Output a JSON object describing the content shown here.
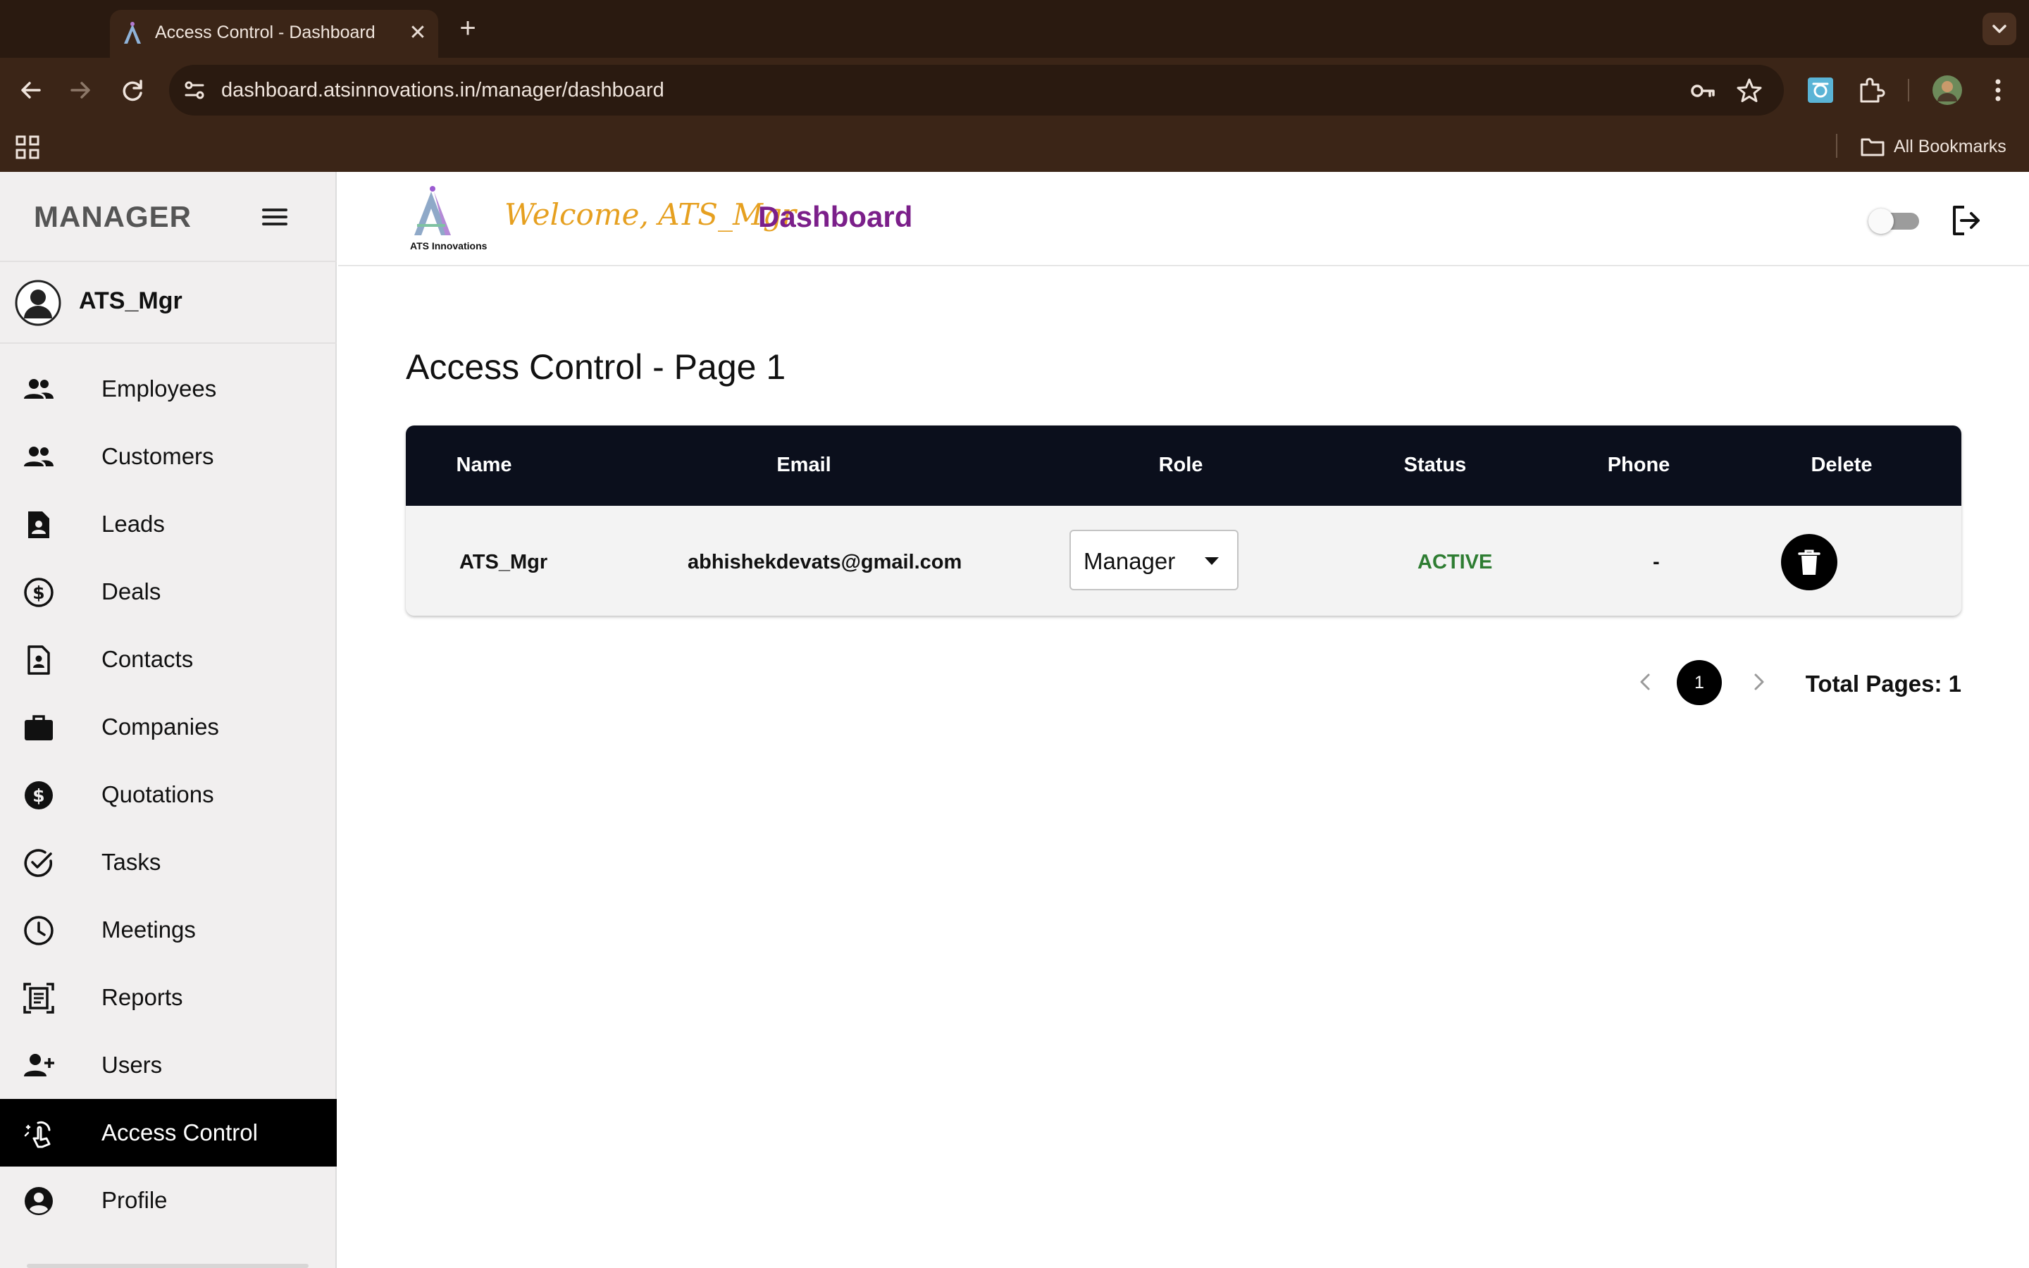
{
  "browser": {
    "tab_title": "Access Control - Dashboard",
    "url": "dashboard.atsinnovations.in/manager/dashboard",
    "bookmarks_label": "All Bookmarks"
  },
  "sidebar": {
    "title": "MANAGER",
    "username": "ATS_Mgr",
    "items": [
      {
        "label": "Employees",
        "icon": "people-icon"
      },
      {
        "label": "Customers",
        "icon": "people-icon"
      },
      {
        "label": "Leads",
        "icon": "document-person-icon"
      },
      {
        "label": "Deals",
        "icon": "dollar-circle-outline-icon"
      },
      {
        "label": "Contacts",
        "icon": "contact-page-icon"
      },
      {
        "label": "Companies",
        "icon": "briefcase-icon"
      },
      {
        "label": "Quotations",
        "icon": "dollar-circle-filled-icon"
      },
      {
        "label": "Tasks",
        "icon": "check-circle-icon"
      },
      {
        "label": "Meetings",
        "icon": "clock-icon"
      },
      {
        "label": "Reports",
        "icon": "document-scanner-icon"
      },
      {
        "label": "Users",
        "icon": "person-add-icon"
      },
      {
        "label": "Access Control",
        "icon": "touch-app-icon",
        "active": true
      },
      {
        "label": "Profile",
        "icon": "account-circle-icon"
      }
    ]
  },
  "header": {
    "logo_text": "ATS Innovations",
    "welcome": "Welcome, ATS_Mgr",
    "title": "Dashboard"
  },
  "main": {
    "heading": "Access Control - Page 1",
    "table": {
      "columns": [
        "Name",
        "Email",
        "Role",
        "Status",
        "Phone",
        "Delete"
      ],
      "rows": [
        {
          "name": "ATS_Mgr",
          "email": "abhishekdevats@gmail.com",
          "role": "Manager",
          "status": "ACTIVE",
          "phone": "-"
        }
      ]
    },
    "pagination": {
      "current_page": "1",
      "total_label": "Total Pages: 1"
    }
  },
  "colors": {
    "sidebar_active_bg": "#000000",
    "table_header_bg": "#0b0f1c",
    "status_active": "#2e7d32",
    "dashboard_title": "#7b1f8a",
    "welcome_text": "#e6a020"
  }
}
